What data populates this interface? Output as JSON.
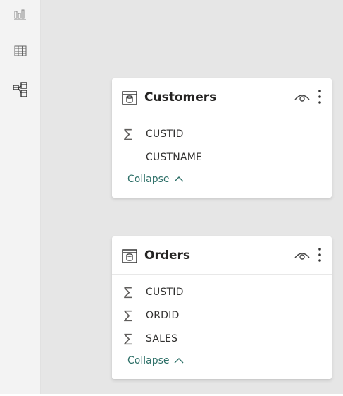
{
  "rail": {
    "items": [
      {
        "name": "report-view-icon"
      },
      {
        "name": "data-view-icon"
      },
      {
        "name": "model-view-icon"
      }
    ]
  },
  "cards": [
    {
      "title": "Customers",
      "fields": [
        {
          "label": "CUSTID",
          "aggregate": true
        },
        {
          "label": "CUSTNAME",
          "aggregate": false
        }
      ],
      "collapse_label": "Collapse"
    },
    {
      "title": "Orders",
      "fields": [
        {
          "label": "CUSTID",
          "aggregate": true
        },
        {
          "label": "ORDID",
          "aggregate": true
        },
        {
          "label": "SALES",
          "aggregate": true
        }
      ],
      "collapse_label": "Collapse"
    }
  ],
  "symbols": {
    "sigma": "∑"
  },
  "colors": {
    "accent": "#2e7068",
    "canvas": "#e6e6e6",
    "rail": "#f3f3f3"
  }
}
